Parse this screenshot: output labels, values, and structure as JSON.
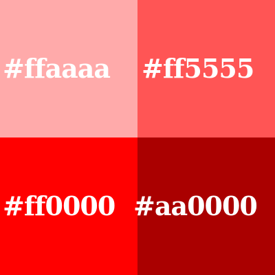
{
  "swatches": [
    {
      "label": "#ffaaaa",
      "color": "#ffaaaa"
    },
    {
      "label": "#ff5555",
      "color": "#ff5555"
    },
    {
      "label": "#ff0000",
      "color": "#ff0000"
    },
    {
      "label": "#aa0000",
      "color": "#aa0000"
    }
  ]
}
